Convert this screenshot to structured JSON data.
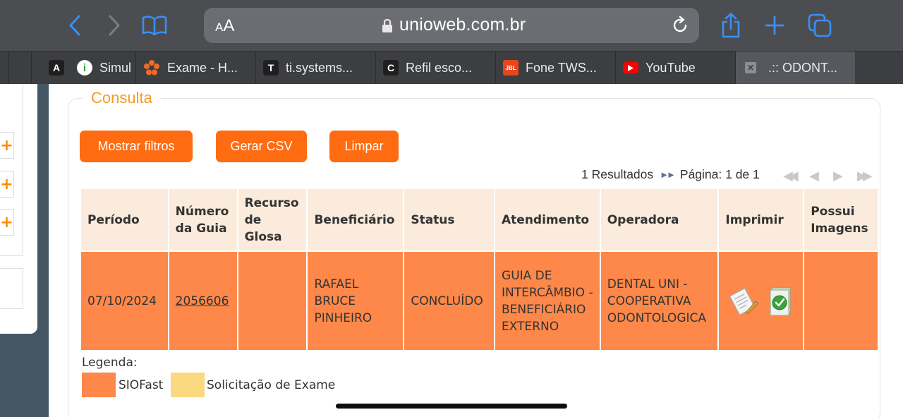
{
  "browser": {
    "text_size_label_small": "A",
    "text_size_label_large": "A",
    "url": "unioweb.com.br",
    "colors": {
      "toolbar": "#4b4d51",
      "accent": "#3a8ff5"
    }
  },
  "tabs": [
    {
      "icon_letter": "A",
      "title": "Simul",
      "active": false
    },
    {
      "icon_letter": "",
      "title": "Exame - H...",
      "active": false
    },
    {
      "icon_letter": "T",
      "title": "ti.systems...",
      "active": false
    },
    {
      "icon_letter": "C",
      "title": "Refil esco...",
      "active": false
    },
    {
      "icon_letter": "",
      "title": "Fone TWS...",
      "active": false
    },
    {
      "icon_letter": "",
      "title": "YouTube",
      "active": false
    },
    {
      "icon_letter": "",
      "title": ".:: ODONT...",
      "active": true
    }
  ],
  "page": {
    "section_title": "Consulta",
    "buttons": {
      "show_filters": "Mostrar filtros",
      "generate_csv": "Gerar CSV",
      "clear": "Limpar"
    },
    "results_text": "1 Resultados",
    "pagination_text": "Página: 1 de 1",
    "table": {
      "headers": {
        "periodo": "Período",
        "numero_guia": "Número da Guia",
        "recurso_glosa": "Recurso de Glosa",
        "beneficiario": "Beneficiário",
        "status": "Status",
        "atendimento": "Atendimento",
        "operadora": "Operadora",
        "imprimir": "Imprimir",
        "possui_imagens": "Possui Imagens"
      },
      "rows": [
        {
          "periodo": "07/10/2024",
          "numero_guia": "2056606",
          "recurso_glosa": "",
          "beneficiario": "RAFAEL BRUCE PINHEIRO",
          "status": "CONCLUÍDO",
          "atendimento": "GUIA DE INTERCÂMBIO - BENEFICIÁRIO EXTERNO",
          "operadora": "DENTAL UNI - COOPERATIVA ODONTOLOGICA",
          "possui_imagens": ""
        }
      ]
    },
    "legend": {
      "title": "Legenda:",
      "items": [
        {
          "label": "SIOFast",
          "color": "#fd8849"
        },
        {
          "label": "Solicitação de Exame",
          "color": "#fbd980"
        }
      ]
    },
    "colors": {
      "button": "#ff6b10",
      "title": "#f49b28",
      "header_bg": "#faebdc",
      "row_bg": "#fd8849"
    }
  }
}
